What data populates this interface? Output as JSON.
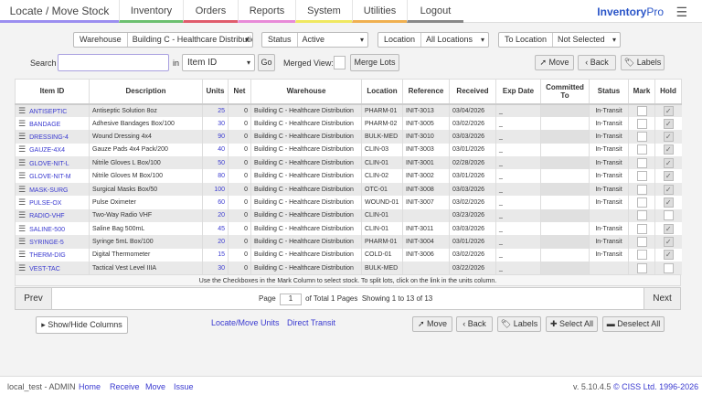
{
  "nav": {
    "tabs": [
      {
        "label": "Locate / Move Stock",
        "color": "#9b8ef0"
      },
      {
        "label": "Inventory",
        "color": "#6cc070"
      },
      {
        "label": "Orders",
        "color": "#e05c6c"
      },
      {
        "label": "Reports",
        "color": "#e88ad8"
      },
      {
        "label": "System",
        "color": "#f0e860"
      },
      {
        "label": "Utilities",
        "color": "#f0b050"
      },
      {
        "label": "Logout",
        "color": "#888888"
      }
    ],
    "brand_a": "Inventory",
    "brand_b": "Pro"
  },
  "filters": {
    "warehouse_label": "Warehouse",
    "warehouse_value": "Building C - Healthcare Distribution",
    "status_label": "Status",
    "status_value": "Active",
    "location_label": "Location",
    "location_value": "All Locations",
    "to_location_label": "To Location",
    "to_location_value": "Not Selected"
  },
  "search": {
    "label": "Search",
    "value": "",
    "in": "in",
    "field": "Item ID",
    "go": "Go",
    "merged_view": "Merged View:",
    "merge_lots": "Merge Lots"
  },
  "actions": {
    "move": "Move",
    "back": "Back",
    "labels": "Labels",
    "select_all": "Select All",
    "deselect_all": "Deselect All"
  },
  "table": {
    "headers": [
      "Item ID",
      "Description",
      "Units",
      "Net",
      "Warehouse",
      "Location",
      "Reference",
      "Received",
      "Exp Date",
      "Committed To",
      "Status",
      "Mark",
      "Hold"
    ],
    "rows": [
      [
        "ANTISEPTIC",
        "Antiseptic Solution 8oz",
        "25",
        "0",
        "Building C - Healthcare Distribution",
        "PHARM-01",
        "INIT-3013",
        "03/04/2026",
        "_",
        "",
        "In-Transit",
        false,
        true
      ],
      [
        "BANDAGE",
        "Adhesive Bandages Box/100",
        "30",
        "0",
        "Building C - Healthcare Distribution",
        "PHARM-02",
        "INIT-3005",
        "03/02/2026",
        "_",
        "",
        "In-Transit",
        false,
        true
      ],
      [
        "DRESSING-4",
        "Wound Dressing 4x4",
        "90",
        "0",
        "Building C - Healthcare Distribution",
        "BULK-MED",
        "INIT-3010",
        "03/03/2026",
        "_",
        "",
        "In-Transit",
        false,
        true
      ],
      [
        "GAUZE-4X4",
        "Gauze Pads 4x4 Pack/200",
        "40",
        "0",
        "Building C - Healthcare Distribution",
        "CLIN-03",
        "INIT-3003",
        "03/01/2026",
        "_",
        "",
        "In-Transit",
        false,
        true
      ],
      [
        "GLOVE-NIT-L",
        "Nitrile Gloves L Box/100",
        "50",
        "0",
        "Building C - Healthcare Distribution",
        "CLIN-01",
        "INIT-3001",
        "02/28/2026",
        "_",
        "",
        "In-Transit",
        false,
        true
      ],
      [
        "GLOVE-NIT-M",
        "Nitrile Gloves M Box/100",
        "80",
        "0",
        "Building C - Healthcare Distribution",
        "CLIN-02",
        "INIT-3002",
        "03/01/2026",
        "_",
        "",
        "In-Transit",
        false,
        true
      ],
      [
        "MASK-SURG",
        "Surgical Masks Box/50",
        "100",
        "0",
        "Building C - Healthcare Distribution",
        "OTC-01",
        "INIT-3008",
        "03/03/2026",
        "_",
        "",
        "In-Transit",
        false,
        true
      ],
      [
        "PULSE-OX",
        "Pulse Oximeter",
        "60",
        "0",
        "Building C - Healthcare Distribution",
        "WOUND-01",
        "INIT-3007",
        "03/02/2026",
        "_",
        "",
        "In-Transit",
        false,
        true
      ],
      [
        "RADIO-VHF",
        "Two-Way Radio VHF",
        "20",
        "0",
        "Building C - Healthcare Distribution",
        "CLIN-01",
        "",
        "03/23/2026",
        "_",
        "",
        "",
        false,
        false
      ],
      [
        "SALINE-500",
        "Saline Bag 500mL",
        "45",
        "0",
        "Building C - Healthcare Distribution",
        "CLIN-01",
        "INIT-3011",
        "03/03/2026",
        "_",
        "",
        "In-Transit",
        false,
        true
      ],
      [
        "SYRINGE-5",
        "Syringe 5mL Box/100",
        "20",
        "0",
        "Building C - Healthcare Distribution",
        "PHARM-01",
        "INIT-3004",
        "03/01/2026",
        "_",
        "",
        "In-Transit",
        false,
        true
      ],
      [
        "THERM-DIG",
        "Digital Thermometer",
        "15",
        "0",
        "Building C - Healthcare Distribution",
        "COLD-01",
        "INIT-3006",
        "03/02/2026",
        "_",
        "",
        "In-Transit",
        false,
        true
      ],
      [
        "VEST-TAC",
        "Tactical Vest Level IIIA",
        "30",
        "0",
        "Building C - Healthcare Distribution",
        "BULK-MED",
        "",
        "03/22/2026",
        "_",
        "",
        "",
        false,
        false
      ]
    ],
    "note": "Use the Checkboxes in the Mark Column to select stock. To split lots, click on the link in the units column."
  },
  "pager": {
    "prev": "Prev",
    "next": "Next",
    "page_label": "Page",
    "page": "1",
    "of_total": "of Total 1 Pages",
    "showing": "Showing 1 to 13 of 13"
  },
  "bottom": {
    "show_hide": "Show/Hide Columns",
    "locate_move_units": "Locate/Move Units",
    "direct_transit": "Direct Transit"
  },
  "footer": {
    "user": "local_test - ADMIN",
    "links": [
      "Home",
      "Receive",
      "Move",
      "Issue"
    ],
    "version": "v. 5.10.4.5",
    "copyright": "© CISS Ltd. 1996-2026"
  }
}
